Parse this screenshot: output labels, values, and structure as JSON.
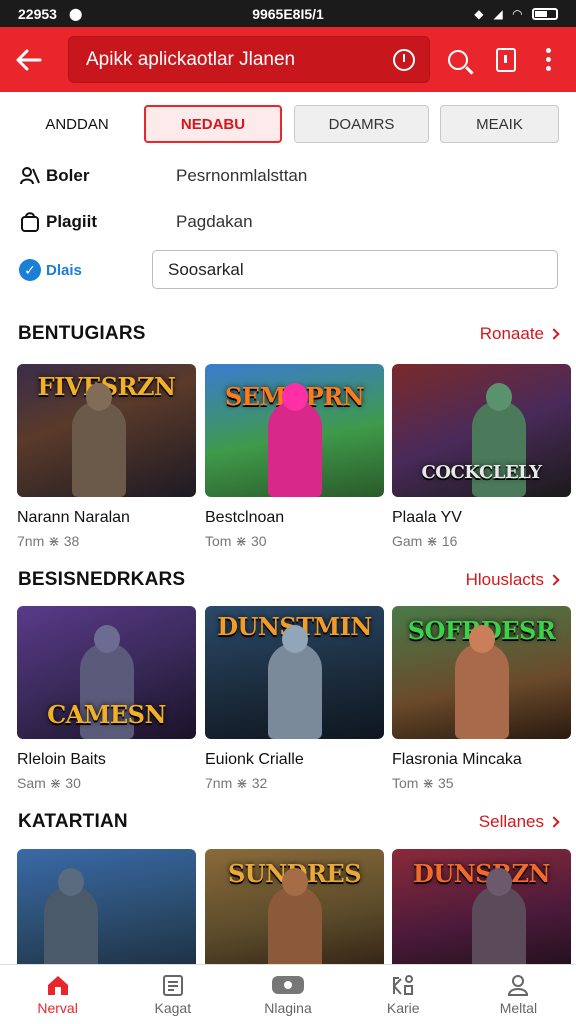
{
  "status_bar": {
    "time": "22953",
    "center_text": "9965E8I5/1"
  },
  "app_bar": {
    "search_text": "Apikk aplickaotlar Jlanen"
  },
  "filter_tabs": [
    {
      "label": "ANDDAN",
      "state": "plain"
    },
    {
      "label": "NEDABU",
      "state": "active"
    },
    {
      "label": "DOAMRS",
      "state": "normal"
    },
    {
      "label": "MEAIK",
      "state": "normal"
    }
  ],
  "info_rows": [
    {
      "label": "Boler",
      "value": "Pesrnonmlalsttan",
      "icon": "people-icon"
    },
    {
      "label": "Plagiit",
      "value": "Pagdakan",
      "icon": "bag-icon"
    },
    {
      "label": "Dlais",
      "icon": "check-circle-icon"
    }
  ],
  "input_field": {
    "value": "Soosarkal"
  },
  "sections": [
    {
      "title": "BENTUGIARS",
      "more_label": "Ronaate",
      "cards": [
        {
          "title": "Narann Naralan",
          "meta": "7nm ⋇ 38",
          "logo": "FIVESRZN"
        },
        {
          "title": "Bestclnoan",
          "meta": "Tom ⋇ 30",
          "logo": "SEMGPRN"
        },
        {
          "title": "Plaala YV",
          "meta": "Gam ⋇ 16",
          "logo": "COCKCLELY"
        }
      ]
    },
    {
      "title": "BESISNEDRKARS",
      "more_label": "Hlouslacts",
      "cards": [
        {
          "title": "Rleloin Baits",
          "meta": "Sam ⋇ 30",
          "logo": "CAMESN"
        },
        {
          "title": "Euionk Crialle",
          "meta": "7nm ⋇ 32",
          "logo": "DUNSTMIN"
        },
        {
          "title": "Flasronia Mincaka",
          "meta": "Tom ⋇ 35",
          "logo": "SOFRDESR"
        }
      ]
    },
    {
      "title": "KATARTIAN",
      "more_label": "Sellanes",
      "cards": [
        {
          "title": "",
          "meta": "",
          "logo": ""
        },
        {
          "title": "",
          "meta": "",
          "logo": "SUNDRES"
        },
        {
          "title": "",
          "meta": "",
          "logo": "DUNSRZN"
        }
      ]
    }
  ],
  "bottom_nav": [
    {
      "label": "Nerval",
      "icon": "home-icon",
      "active": true
    },
    {
      "label": "Kagat",
      "icon": "calendar-icon",
      "active": false
    },
    {
      "label": "Nlagina",
      "icon": "play-icon",
      "active": false
    },
    {
      "label": "Karie",
      "icon": "apps-icon",
      "active": false
    },
    {
      "label": "Meltal",
      "icon": "profile-icon",
      "active": false
    }
  ],
  "colors": {
    "accent": "#e8262b",
    "link": "#d3181d",
    "check_blue": "#1a7fd6"
  }
}
